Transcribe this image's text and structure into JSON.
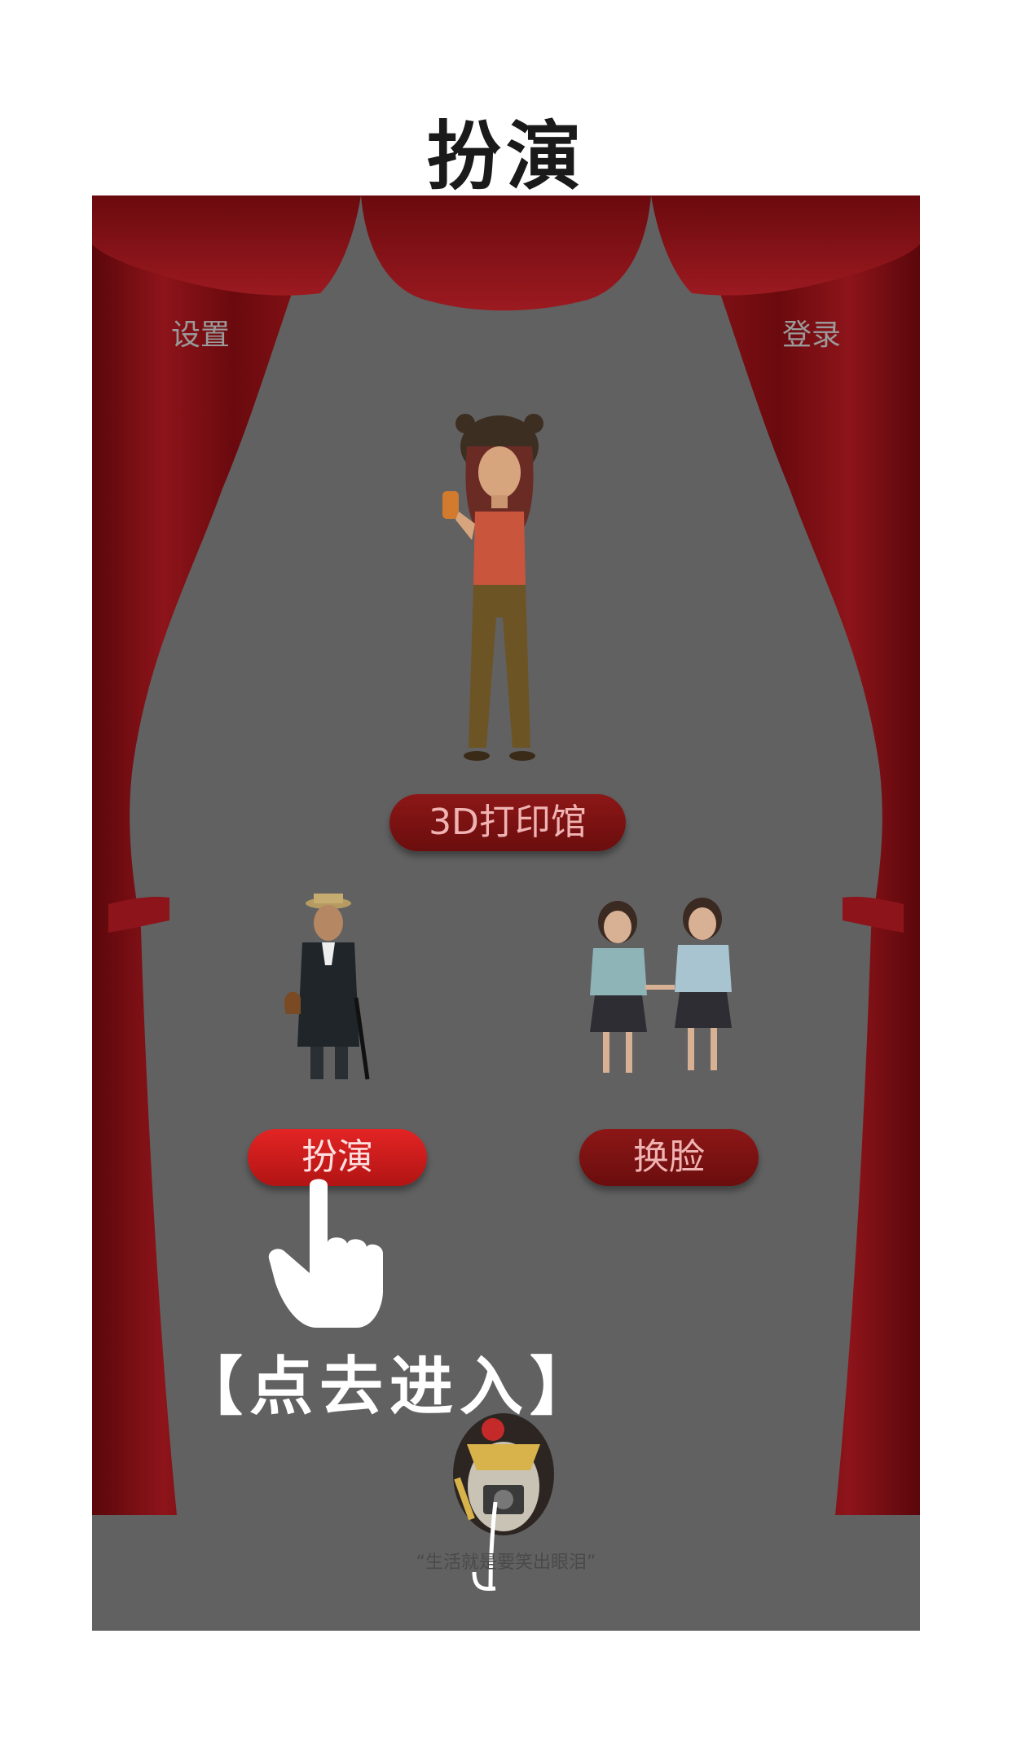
{
  "page_title": "扮演",
  "nav": {
    "settings": "设置",
    "login": "登录"
  },
  "buttons": {
    "print3d": "3D打印馆",
    "role_play": "扮演",
    "face_swap": "换脸"
  },
  "hint_text": "【点去进入】",
  "slogan": "“生活就是要笑出眼泪”",
  "colors": {
    "background": "#616161",
    "curtain": "#7a0f12",
    "button_active": "#d21c1c",
    "button_dim": "#7a1212"
  },
  "icons": [
    "hand-pointer-icon",
    "arrow-down-icon",
    "curtain",
    "avatar-girl",
    "avatar-gentleman",
    "avatar-two-girls",
    "mascot-penguin"
  ]
}
